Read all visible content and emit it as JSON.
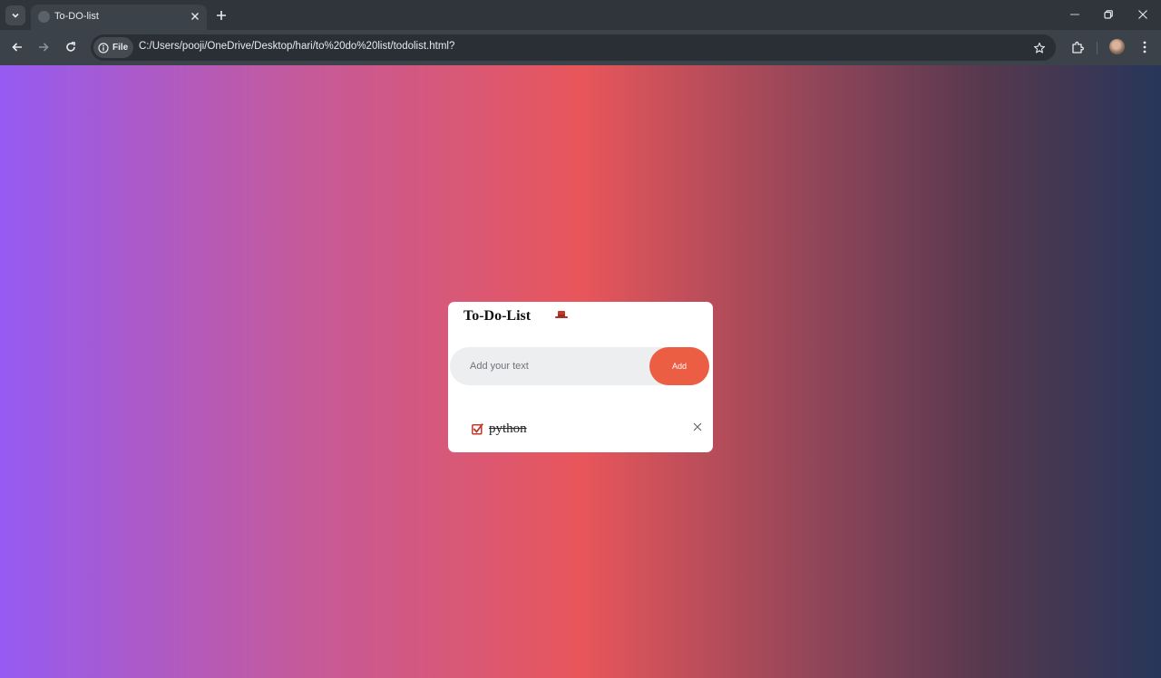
{
  "browser": {
    "tab_title": "To-DO-list",
    "site_chip_label": "File",
    "url": "C:/Users/pooji/OneDrive/Desktop/hari/to%20do%20list/todolist.html?"
  },
  "app": {
    "title": "To-Do-List",
    "input_placeholder": "Add your text",
    "input_value": "",
    "add_label": "Add",
    "items": [
      {
        "text": "python",
        "checked": true
      }
    ]
  },
  "colors": {
    "accent": "#ec5e44",
    "checkbox": "#c0392b"
  }
}
